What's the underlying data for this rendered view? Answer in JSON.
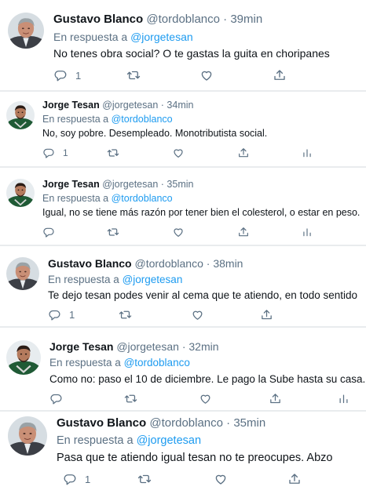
{
  "tweets": [
    {
      "name": "Gustavo Blanco",
      "handle": "@tordoblanco",
      "time": "39min",
      "reply_prefix": "En respuesta a",
      "reply_to": "@jorgetesan",
      "text": "No tenes obra social? O te gastas la guita en choripanes",
      "reply_count": "1",
      "avatar_icon": "avatar-gustavo"
    },
    {
      "name": "Jorge Tesan",
      "handle": "@jorgetesan",
      "time": "34min",
      "reply_prefix": "En respuesta a",
      "reply_to": "@tordoblanco",
      "text": "No, soy pobre. Desempleado. Monotributista social.",
      "reply_count": "1",
      "avatar_icon": "avatar-jorge"
    },
    {
      "name": "Jorge Tesan",
      "handle": "@jorgetesan",
      "time": "35min",
      "reply_prefix": "En respuesta a",
      "reply_to": "@tordoblanco",
      "text": "Igual, no se tiene más razón por tener bien el colesterol, o estar en peso.",
      "reply_count": "",
      "avatar_icon": "avatar-jorge"
    },
    {
      "name": "Gustavo Blanco",
      "handle": "@tordoblanco",
      "time": "38min",
      "reply_prefix": "En respuesta a",
      "reply_to": "@jorgetesan",
      "text": "Te dejo tesan podes venir al cema que te atiendo, en todo sentido",
      "reply_count": "1",
      "avatar_icon": "avatar-gustavo"
    },
    {
      "name": "Jorge Tesan",
      "handle": "@jorgetesan",
      "time": "32min",
      "reply_prefix": "En respuesta a",
      "reply_to": "@tordoblanco",
      "text": "Como no: paso el 10 de diciembre. Le pago la Sube hasta su casa.",
      "reply_count": "",
      "avatar_icon": "avatar-jorge"
    },
    {
      "name": "Gustavo Blanco",
      "handle": "@tordoblanco",
      "time": "35min",
      "reply_prefix": "En respuesta a",
      "reply_to": "@jorgetesan",
      "text": "Pasa que te atiendo igual tesan no te preocupes. Abzo",
      "reply_count": "1",
      "avatar_icon": "avatar-gustavo"
    }
  ],
  "separator": "·",
  "icons": [
    "reply-icon",
    "retweet-icon",
    "like-icon",
    "share-icon",
    "analytics-icon"
  ],
  "colors": {
    "link": "#1d9bf0",
    "muted": "#5b7083",
    "text": "#0f1419"
  }
}
